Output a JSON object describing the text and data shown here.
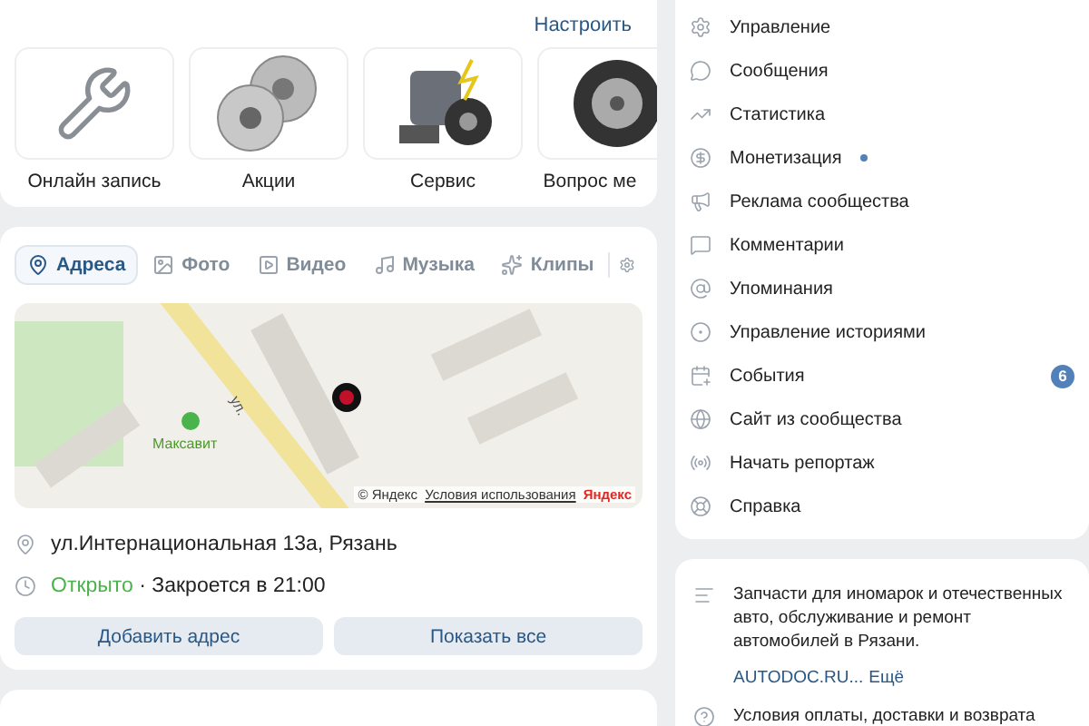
{
  "services": {
    "action": "Настроить",
    "tiles": [
      {
        "kind": "wrench",
        "label": "Онлайн запись"
      },
      {
        "kind": "rims",
        "label": "Акции"
      },
      {
        "kind": "engine",
        "label": "Сервис"
      },
      {
        "kind": "tire",
        "label": "Вопрос ме"
      }
    ]
  },
  "location": {
    "tabs": [
      {
        "kind": "pin",
        "label": "Адреса",
        "selected": true
      },
      {
        "kind": "photo",
        "label": "Фото",
        "selected": false
      },
      {
        "kind": "video",
        "label": "Видео",
        "selected": false
      },
      {
        "kind": "music",
        "label": "Музыка",
        "selected": false
      },
      {
        "kind": "clips",
        "label": "Клипы",
        "selected": false
      }
    ],
    "map": {
      "poi": "Максавит",
      "street": "ул.",
      "copyright": "© Яндекс",
      "terms": "Условия использования",
      "brand": "Яндекс"
    },
    "address": "ул.Интернациональная 13а, Рязань",
    "status": "Открыто",
    "hours": "· Закроется в 21:00",
    "buttons": [
      "Добавить адрес",
      "Показать все"
    ]
  },
  "menu": [
    {
      "kind": "gear",
      "label": "Управление"
    },
    {
      "kind": "chat",
      "label": "Сообщения"
    },
    {
      "kind": "chart",
      "label": "Статистика"
    },
    {
      "kind": "coin",
      "label": "Монетизация",
      "dot": true
    },
    {
      "kind": "megaphone",
      "label": "Реклама сообщества"
    },
    {
      "kind": "comment",
      "label": "Комментарии"
    },
    {
      "kind": "at",
      "label": "Упоминания"
    },
    {
      "kind": "story",
      "label": "Управление историями"
    },
    {
      "kind": "calendar",
      "label": "События",
      "badge": "6"
    },
    {
      "kind": "globe",
      "label": "Сайт из сообщества"
    },
    {
      "kind": "live",
      "label": "Начать репортаж"
    },
    {
      "kind": "help",
      "label": "Справка"
    }
  ],
  "about": {
    "description": "Запчасти для иномарок и отечественных авто, обслуживание и ремонт автомобилей в Рязани.",
    "link": "AUTODOC.RU...",
    "more": "Ещё",
    "terms": "Условия оплаты, доставки и возврата"
  }
}
